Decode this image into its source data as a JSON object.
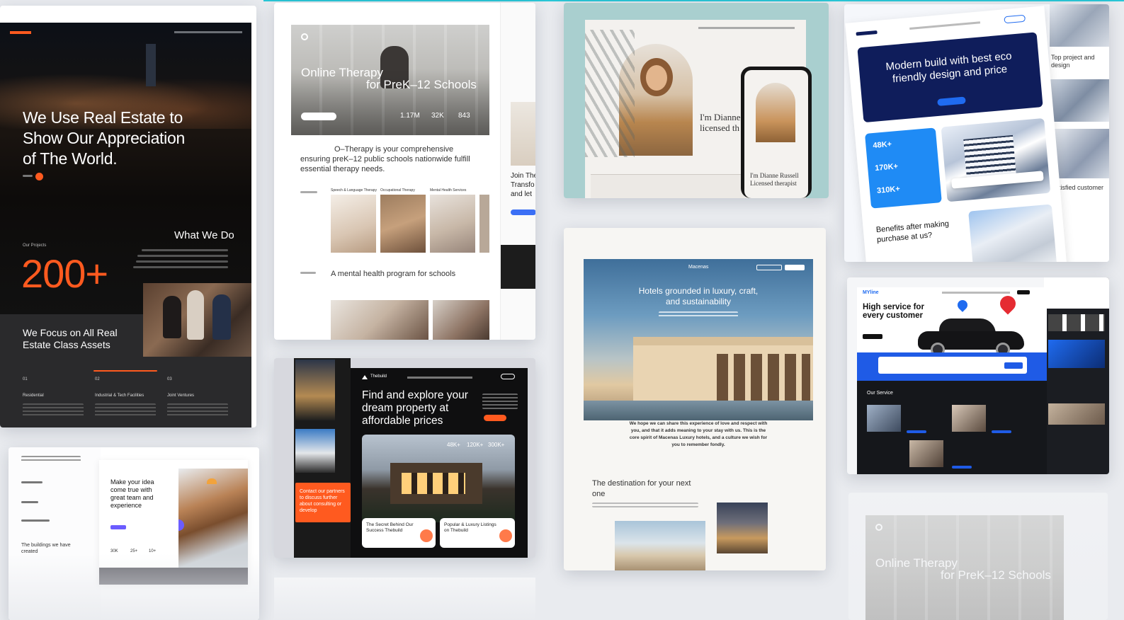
{
  "colors": {
    "page_bg": "#e9ebef",
    "accent_orange": "#ff5a1f",
    "accent_blue": "#1f6bf0",
    "navy": "#0f1d5b",
    "teal": "#a9cfcf",
    "cyan": "#29c6d6"
  },
  "realestate": {
    "hero_title": "We Use Real Estate to Show Our Appreciation of The World.",
    "what_we_do": "What We Do",
    "our_projects": "Our Projects",
    "stat": "200+",
    "focus": "We Focus on All Real Estate Class Assets",
    "cols": [
      {
        "num": "01",
        "title": "Residential"
      },
      {
        "num": "02",
        "title": "Industrial & Tech Facilities"
      },
      {
        "num": "03",
        "title": "Joint Ventures"
      }
    ]
  },
  "therapy": {
    "hero_line1": "Online Therapy",
    "hero_line2": "for PreK–12 Schools",
    "stats": [
      "1.17M",
      "32K",
      "843"
    ],
    "intro": "O–Therapy is your comprehensive ensuring preK–12 public schools nationwide fulfill essential therapy needs.",
    "services": [
      "Speech & Language Therapy",
      "Occupational Therapy",
      "Mental Health Services"
    ],
    "program_title": "A mental health program for schools",
    "side_text": "Join The Transfo and let"
  },
  "counselor": {
    "headline": "I'm Dianne licensed th",
    "phone_name": "I'm Dianne Russell Licensed therapist"
  },
  "eco": {
    "headline": "Modern build with best eco friendly design and price",
    "stats": [
      "48K+",
      "170K+",
      "310K+"
    ],
    "benefits": "Benefits after making purchase at us?",
    "side_top": "Top project and design",
    "side_bottom": "Satisfied customer"
  },
  "hotel": {
    "brand": "Macenas",
    "headline": "Hotels grounded in luxury, craft, and sustainability",
    "quote": "We hope we can share this experience of love and respect with you, and that it adds meaning to your stay with us. This is the core spirit of Macenas Luxury hotels, and a culture we wish for you to remember fondly.",
    "dest_title": "The destination for your next one"
  },
  "thebuild": {
    "brand": "Thebuild",
    "headline": "Find and explore your dream property at affordable prices",
    "stats": [
      "48K+",
      "120K+",
      "300K+"
    ],
    "card1": "The Secret Behind Our Success Thebuild",
    "card2": "Popular & Luxury Listings on Thebuild",
    "side_text": "Contact our partners to discuss further about consulting or develop"
  },
  "construction": {
    "headline": "Make your idea come true with great team and experience",
    "stats": [
      "30K",
      "25+",
      "10+"
    ],
    "left_text": "The buildings we have created"
  },
  "myline": {
    "brand": "MYline",
    "headline": "High service for every customer",
    "service": "Our Service"
  },
  "therapy_faded": {
    "line1": "Online Therapy",
    "line2": "for PreK–12 Schools"
  }
}
